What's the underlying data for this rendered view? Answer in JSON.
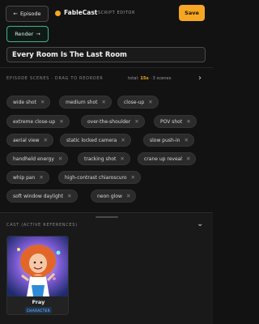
{
  "header": {
    "back_label": "Episode",
    "brand": "FableCast",
    "subtitle": "SCRIPT EDITOR",
    "save_label": "Save",
    "render_label": "Render",
    "accent_color": "#f5a623"
  },
  "episode": {
    "title": "Every Room Is The Last Room"
  },
  "scenes": {
    "label": "EPISODE SCENES · DRAG TO REORDER",
    "total_prefix": "total:",
    "total_value": "15s",
    "count_text": "· 3 scenes"
  },
  "tags": [
    "wide shot",
    "medium shot",
    "close-up",
    "extreme close-up",
    "over-the-shoulder",
    "POV shot",
    "aerial view",
    "static locked camera",
    "slow push-in",
    "handheld energy",
    "tracking shot",
    "crane up reveal",
    "whip pan",
    "high-contrast chiaroscuro",
    "soft window daylight",
    "neon glow"
  ],
  "cast": {
    "label": "CAST (ACTIVE REFERENCES)",
    "members": [
      {
        "name": "Fray",
        "badge": "CHARACTER"
      }
    ]
  }
}
